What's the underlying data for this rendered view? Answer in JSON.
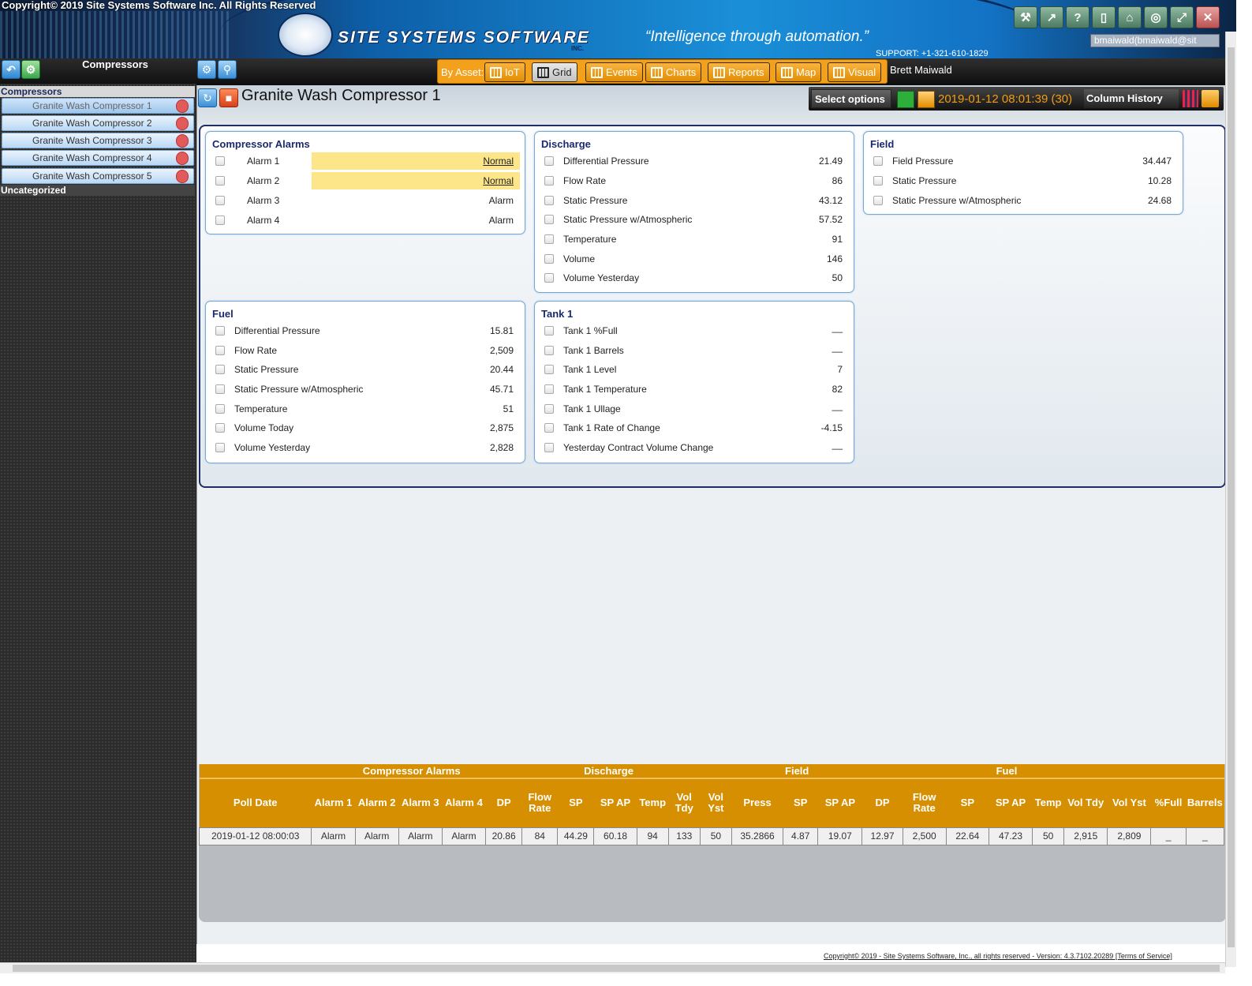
{
  "header": {
    "copyright_top": "Copyright© 2019 Site Systems Software Inc. All Rights Reserved",
    "logo": "SITE SYSTEMS SOFTWARE",
    "logo_inc": "INC.",
    "tagline": "“Intelligence through automation.”",
    "support": "SUPPORT: +1-321-610-1829",
    "user_select": "bmaiwald(bmaiwald@sit",
    "icons": [
      "tools-icon",
      "chart-trend-icon",
      "help-icon",
      "mobile-icon",
      "home-icon",
      "target-icon",
      "expand-icon",
      "close-icon"
    ]
  },
  "sidebar": {
    "title": "Compressors",
    "group": "Compressors",
    "items": [
      {
        "label": "Granite Wash Compressor 1"
      },
      {
        "label": "Granite Wash Compressor 2"
      },
      {
        "label": "Granite Wash Compressor 3"
      },
      {
        "label": "Granite Wash Compressor 4"
      },
      {
        "label": "Granite Wash Compressor 5"
      }
    ],
    "uncategorized": "Uncategorized"
  },
  "toolbar": {
    "by_asset": "By Asset:",
    "buttons": [
      "IoT",
      "Grid",
      "Events",
      "Charts",
      "Reports",
      "Map",
      "Visual"
    ],
    "selected": "Grid",
    "user": "Brett Maiwald"
  },
  "main": {
    "title": "Granite Wash Compressor 1",
    "select_options": "Select options",
    "timestamp": "2019-01-12 08:01:39 (30)",
    "column_history": "Column History"
  },
  "panels": {
    "alarms": {
      "title": "Compressor Alarms",
      "rows": [
        {
          "label": "Alarm 1",
          "value": "Normal"
        },
        {
          "label": "Alarm 2",
          "value": "Normal"
        },
        {
          "label": "Alarm 3",
          "value": "Alarm"
        },
        {
          "label": "Alarm 4",
          "value": "Alarm"
        }
      ]
    },
    "discharge": {
      "title": "Discharge",
      "rows": [
        {
          "label": "Differential Pressure",
          "value": "21.49"
        },
        {
          "label": "Flow Rate",
          "value": "86"
        },
        {
          "label": "Static Pressure",
          "value": "43.12"
        },
        {
          "label": "Static Pressure w/Atmospheric",
          "value": "57.52"
        },
        {
          "label": "Temperature",
          "value": "91"
        },
        {
          "label": "Volume",
          "value": "146"
        },
        {
          "label": "Volume Yesterday",
          "value": "50"
        }
      ]
    },
    "field": {
      "title": "Field",
      "rows": [
        {
          "label": "Field Pressure",
          "value": "34.447"
        },
        {
          "label": "Static Pressure",
          "value": "10.28"
        },
        {
          "label": "Static Pressure w/Atmospheric",
          "value": "24.68"
        }
      ]
    },
    "fuel": {
      "title": "Fuel",
      "rows": [
        {
          "label": "Differential Pressure",
          "value": "15.81"
        },
        {
          "label": "Flow Rate",
          "value": "2,509"
        },
        {
          "label": "Static Pressure",
          "value": "20.44"
        },
        {
          "label": "Static Pressure w/Atmospheric",
          "value": "45.71"
        },
        {
          "label": "Temperature",
          "value": "51"
        },
        {
          "label": "Volume Today",
          "value": "2,875"
        },
        {
          "label": "Volume Yesterday",
          "value": "2,828"
        }
      ]
    },
    "tank": {
      "title": "Tank 1",
      "rows": [
        {
          "label": "Tank 1 %Full",
          "value": "__"
        },
        {
          "label": "Tank 1 Barrels",
          "value": "__"
        },
        {
          "label": "Tank 1 Level",
          "value": "7"
        },
        {
          "label": "Tank 1 Temperature",
          "value": "82"
        },
        {
          "label": "Tank 1 Ullage",
          "value": "__"
        },
        {
          "label": "Tank 1 Rate of Change",
          "value": "-4.15"
        },
        {
          "label": "Yesterday Contract Volume Change",
          "value": "__"
        }
      ]
    }
  },
  "history": {
    "groups": [
      "Compressor Alarms",
      "Discharge",
      "Field",
      "Fuel"
    ],
    "columns": [
      "Poll Date",
      "Alarm 1",
      "Alarm 2",
      "Alarm 3",
      "Alarm 4",
      "DP",
      "Flow Rate",
      "SP",
      "SP AP",
      "Temp",
      "Vol Tdy",
      "Vol Yst",
      "Press",
      "SP",
      "SP AP",
      "DP",
      "Flow Rate",
      "SP",
      "SP AP",
      "Temp",
      "Vol Tdy",
      "Vol Yst",
      "%Full",
      "Barrels"
    ],
    "row": [
      "2019-01-12 08:00:03",
      "Alarm",
      "Alarm",
      "Alarm",
      "Alarm",
      "20.86",
      "84",
      "44.29",
      "60.18",
      "94",
      "133",
      "50",
      "35.2866",
      "4.87",
      "19.07",
      "12.97",
      "2,500",
      "22.64",
      "47.23",
      "50",
      "2,915",
      "2,809",
      "_",
      "_"
    ]
  },
  "footer": {
    "text": "Copyright© 2019 - Site Systems Software, Inc., all rights reserved - Version: 4.3.7102.20289 [Terms of Service]"
  }
}
